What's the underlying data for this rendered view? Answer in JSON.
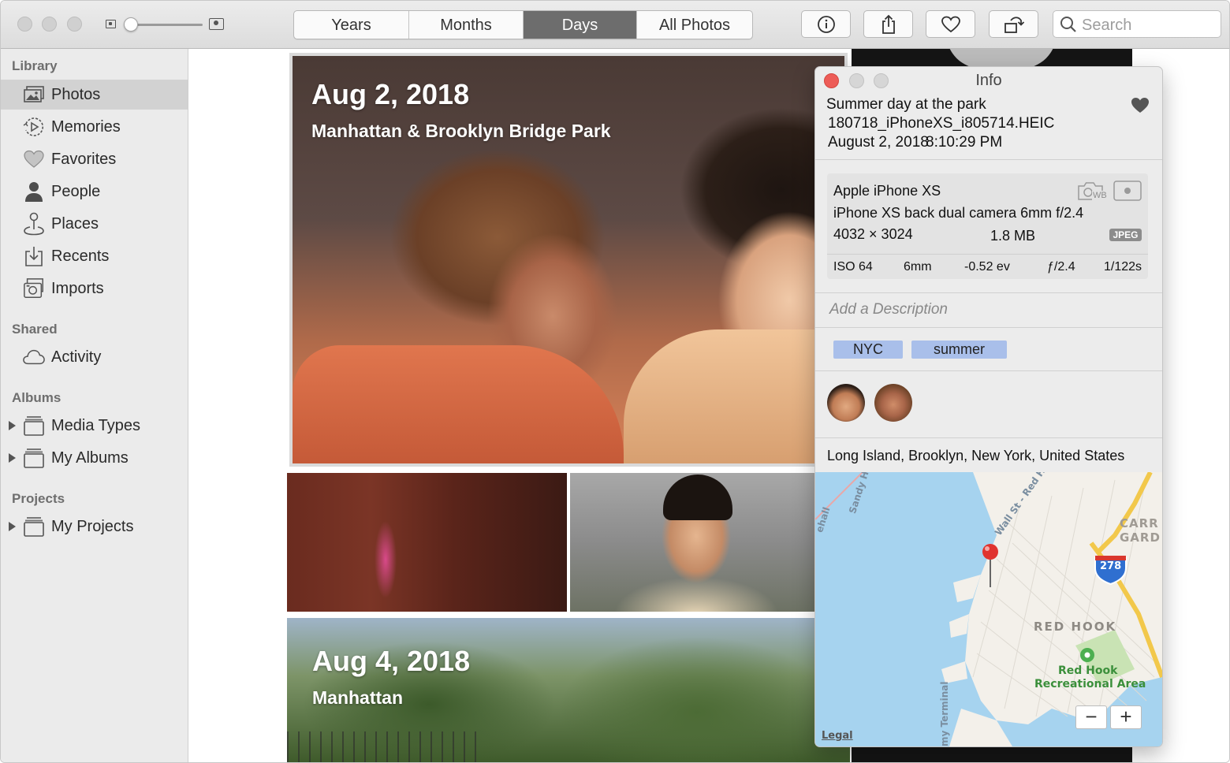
{
  "toolbar": {
    "view_tabs": [
      {
        "label": "Years"
      },
      {
        "label": "Months"
      },
      {
        "label": "Days"
      },
      {
        "label": "All Photos"
      }
    ],
    "active_tab": "Days",
    "search_placeholder": "Search",
    "icons": [
      "info-icon",
      "share-icon",
      "heart-icon",
      "rotate-icon",
      "search-icon"
    ]
  },
  "sidebar": {
    "sections": {
      "library": "Library",
      "shared": "Shared",
      "albums": "Albums",
      "projects": "Projects"
    },
    "library_items": [
      {
        "label": "Photos",
        "icon": "photos-icon"
      },
      {
        "label": "Memories",
        "icon": "memories-icon"
      },
      {
        "label": "Favorites",
        "icon": "heart-icon"
      },
      {
        "label": "People",
        "icon": "person-icon"
      },
      {
        "label": "Places",
        "icon": "pin-icon"
      },
      {
        "label": "Recents",
        "icon": "recents-icon"
      },
      {
        "label": "Imports",
        "icon": "camera-icon"
      }
    ],
    "shared_items": [
      {
        "label": "Activity",
        "icon": "cloud-icon"
      }
    ],
    "album_items": [
      {
        "label": "Media Types",
        "icon": "folder-icon"
      },
      {
        "label": "My Albums",
        "icon": "folder-icon"
      }
    ],
    "project_items": [
      {
        "label": "My Projects",
        "icon": "folder-icon"
      }
    ],
    "selected": "Photos"
  },
  "content": {
    "days": [
      {
        "date": "Aug 2, 2018",
        "location": "Manhattan & Brooklyn Bridge Park"
      },
      {
        "date": "Aug 4, 2018",
        "location": "Manhattan"
      }
    ]
  },
  "info_panel": {
    "title": "Info",
    "photo_title": "Summer day at the park",
    "filename": "180718_iPhoneXS_i805714.HEIC",
    "date": "August 2, 2018",
    "time": "8:10:29 PM",
    "camera": {
      "model": "Apple iPhone XS",
      "lens": "iPhone XS back dual camera 6mm f/2.4",
      "dimensions": "4032 × 3024",
      "size": "1.8 MB",
      "format": "JPEG",
      "wb_label": "WB",
      "exif": [
        "ISO 64",
        "6mm",
        "-0.52 ev",
        "ƒ/2.4",
        "1/122s"
      ]
    },
    "description_placeholder": "Add a Description",
    "keywords": [
      "NYC",
      "summer"
    ],
    "location": "Long Island, Brooklyn, New York, United States",
    "map": {
      "labels": {
        "carr": "CARR",
        "gard": "GARD",
        "red_hook": "RED HOOK",
        "park_1": "Red Hook",
        "park_2": "Recreational Area",
        "highway": "278",
        "sandy_hook": "Sandy Hook - Mid",
        "wall_st": "Wall St - Red H",
        "whitehall": "ehall",
        "terminal": "my Terminal",
        "legal": "Legal"
      },
      "zoom_out": "−",
      "zoom_in": "+"
    }
  },
  "colors": {
    "close_red": "#ed5c57",
    "active_tab_bg": "#6d6d6d",
    "keyword_bg": "#a9bfea",
    "map_water": "#a6d3ef",
    "map_land": "#f3f0ea",
    "highway_yellow": "#f2c84b",
    "interstate_blue": "#2f6fd0"
  }
}
